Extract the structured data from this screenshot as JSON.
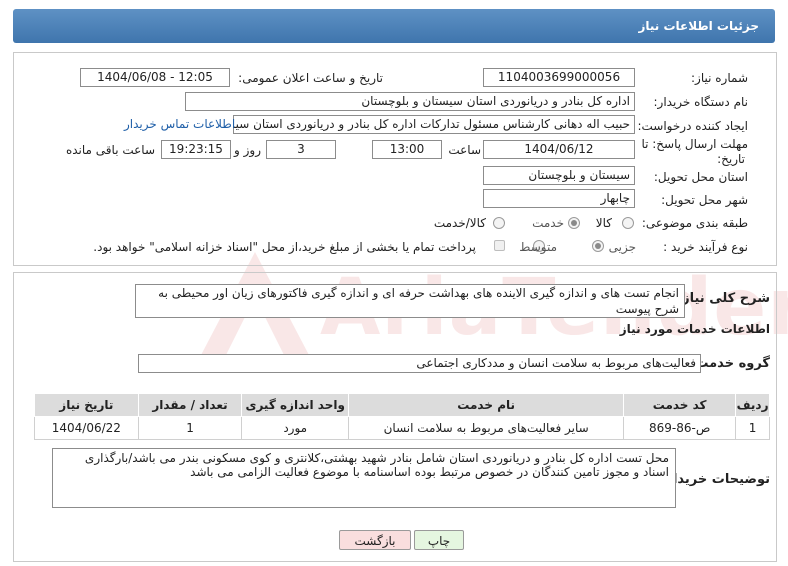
{
  "header": {
    "title": "جزئیات اطلاعات نیاز"
  },
  "fields": {
    "need_number_label": "شماره نیاز:",
    "need_number": "1104003699000056",
    "announce_label": "تاریخ و ساعت اعلان عمومی:",
    "announce_value": "1404/06/08 - 12:05",
    "buyer_org_label": "نام دستگاه خریدار:",
    "buyer_org": "اداره کل بنادر و دریانوردی استان سیستان و بلوچستان",
    "requester_label": "ایجاد کننده درخواست:",
    "requester": "حبیب اله دهانی کارشناس مسئول تدارکات اداره کل بنادر و دریانوردی استان سیستان و بلوچستان",
    "contact_link": "اطلاعات تماس خریدار",
    "deadline_label_1": "مهلت ارسال پاسخ: تا",
    "deadline_label_2": "تاریخ:",
    "deadline_date": "1404/06/12",
    "time_label": "ساعت",
    "deadline_time": "13:00",
    "days_value": "3",
    "days_label": "روز و",
    "remaining_time": "19:23:15",
    "remaining_label": "ساعت باقی مانده",
    "province_label": "استان محل تحویل:",
    "province": "سیستان و بلوچستان",
    "city_label": "شهر محل تحویل:",
    "city": "چابهار",
    "category_label": "طبقه بندی موضوعی:",
    "category_options": [
      "کالا",
      "خدمت",
      "کالا/خدمت"
    ],
    "category_selected": "خدمت",
    "process_label": "نوع فرآیند خرید :",
    "process_options": [
      "جزیی",
      "متوسط"
    ],
    "process_selected": "جزیی",
    "payment_note": "پرداخت تمام یا بخشی از مبلغ خرید،از محل \"اسناد خزانه اسلامی\" خواهد بود."
  },
  "summary": {
    "label": "شرح کلی نیاز:",
    "text": "انجام تست های و اندازه گیری الاینده های بهداشت حرفه ای و اندازه گیری فاکتورهای زیان اور محیطی به شرح پیوست"
  },
  "services": {
    "section_title": "اطلاعات خدمات مورد نیاز",
    "group_label": "گروه خدمت:",
    "group_value": "فعالیت‌های مربوط به سلامت انسان و مددکاری اجتماعی",
    "columns": [
      "ردیف",
      "کد خدمت",
      "نام خدمت",
      "واحد اندازه گیری",
      "تعداد / مقدار",
      "تاریخ نیاز"
    ],
    "rows": [
      [
        "1",
        "ص-86-869",
        "سایر فعالیت‌های مربوط به سلامت انسان",
        "مورد",
        "1",
        "1404/06/22"
      ]
    ]
  },
  "buyer_notes": {
    "label": "توضیحات خریدار:",
    "text": "محل تست اداره کل بنادر و دریانوردی استان شامل بنادر شهید بهشتی،کلانتری و کوی مسکونی بندر می باشد/بارگذاری اسناد و مجوز تامین کنندگان در خصوص مرتبط بوده اساسنامه با موضوع فعالیت الزامی می باشد"
  },
  "buttons": {
    "print": "چاپ",
    "back": "بازگشت"
  },
  "watermark": "AriaTender.neT",
  "colors": {
    "header": "#4a7fb5",
    "link": "#1f5fa8",
    "back_button": "#f9dede",
    "print_button": "#e5f6e0"
  }
}
